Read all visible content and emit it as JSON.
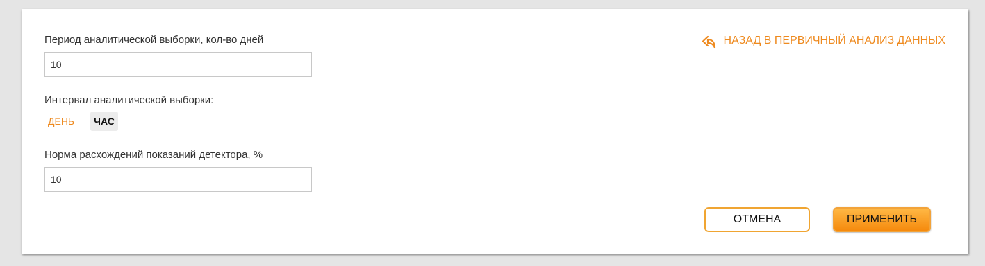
{
  "form": {
    "period": {
      "label": "Период аналитической выборки, кол-во дней",
      "value": "10"
    },
    "interval": {
      "label": "Интервал аналитической выборки:",
      "options": [
        "ДЕНЬ",
        "ЧАС"
      ],
      "selected": "ЧАС"
    },
    "discrepancy": {
      "label": "Норма расхождений показаний детектора, %",
      "value": "10"
    }
  },
  "back_link": {
    "label": "НАЗАД В ПЕРВИЧНЫЙ АНАЛИЗ ДАННЫХ",
    "icon": "reply-arrow-icon"
  },
  "actions": {
    "cancel_label": "ОТМЕНА",
    "apply_label": "ПРИМЕНИТЬ"
  },
  "colors": {
    "accent": "#ee8a1f",
    "apply_top": "#ffb845",
    "apply_bottom": "#f58a0d",
    "selected_bg": "#ececec"
  }
}
